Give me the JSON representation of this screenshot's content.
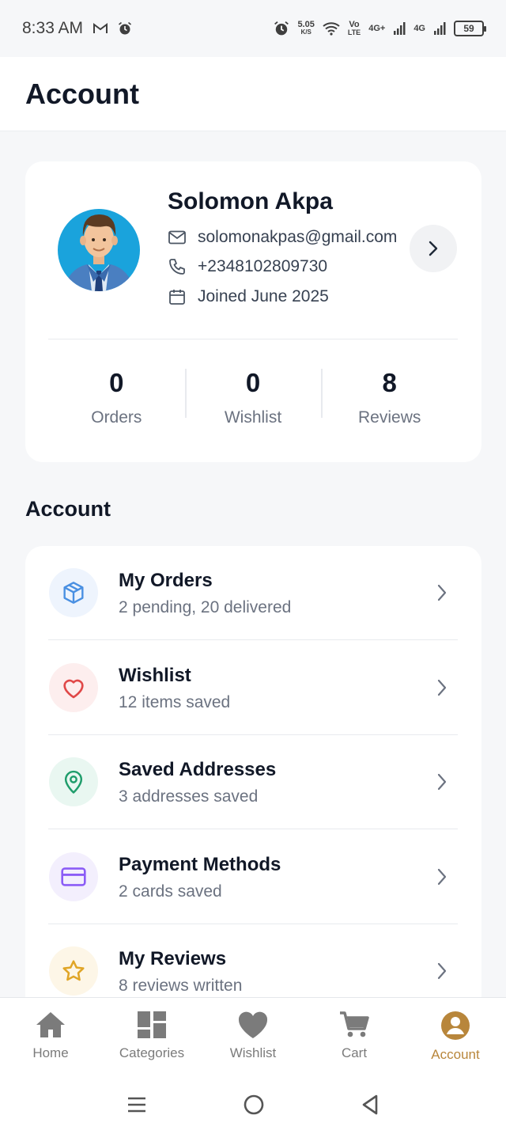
{
  "status_bar": {
    "time": "8:33 AM",
    "speed_value": "5.05",
    "speed_unit": "K/S",
    "volte_top": "Vo",
    "volte_bottom": "LTE",
    "net1": "4G+",
    "net2": "4G",
    "battery": "59"
  },
  "header": {
    "title": "Account"
  },
  "profile": {
    "name": "Solomon Akpa",
    "email": "solomonakpas@gmail.com",
    "phone": "+2348102809730",
    "joined": "Joined June 2025",
    "stats": [
      {
        "value": "0",
        "label": "Orders"
      },
      {
        "value": "0",
        "label": "Wishlist"
      },
      {
        "value": "8",
        "label": "Reviews"
      }
    ]
  },
  "section": {
    "title": "Account"
  },
  "menu": [
    {
      "title": "My Orders",
      "subtitle": "2 pending, 20 delivered",
      "icon": "package-icon",
      "color": "#4a90e2",
      "bg": "#eef4fd"
    },
    {
      "title": "Wishlist",
      "subtitle": "12 items saved",
      "icon": "heart-outline-icon",
      "color": "#e04848",
      "bg": "#fdeeee"
    },
    {
      "title": "Saved Addresses",
      "subtitle": "3 addresses saved",
      "icon": "map-pin-icon",
      "color": "#1f9d6b",
      "bg": "#e9f7f1"
    },
    {
      "title": "Payment Methods",
      "subtitle": "2 cards saved",
      "icon": "credit-card-icon",
      "color": "#8b5cf6",
      "bg": "#f3effd"
    },
    {
      "title": "My Reviews",
      "subtitle": "8 reviews written",
      "icon": "star-icon",
      "color": "#e0a526",
      "bg": "#fdf6e7"
    }
  ],
  "bottom_nav": [
    {
      "label": "Home",
      "icon": "home-icon"
    },
    {
      "label": "Categories",
      "icon": "grid-icon"
    },
    {
      "label": "Wishlist",
      "icon": "heart-icon"
    },
    {
      "label": "Cart",
      "icon": "cart-icon"
    },
    {
      "label": "Account",
      "icon": "user-circle-icon",
      "active": true
    }
  ],
  "colors": {
    "accent": "#b8863b",
    "nav_inactive": "#7b7b7b"
  }
}
